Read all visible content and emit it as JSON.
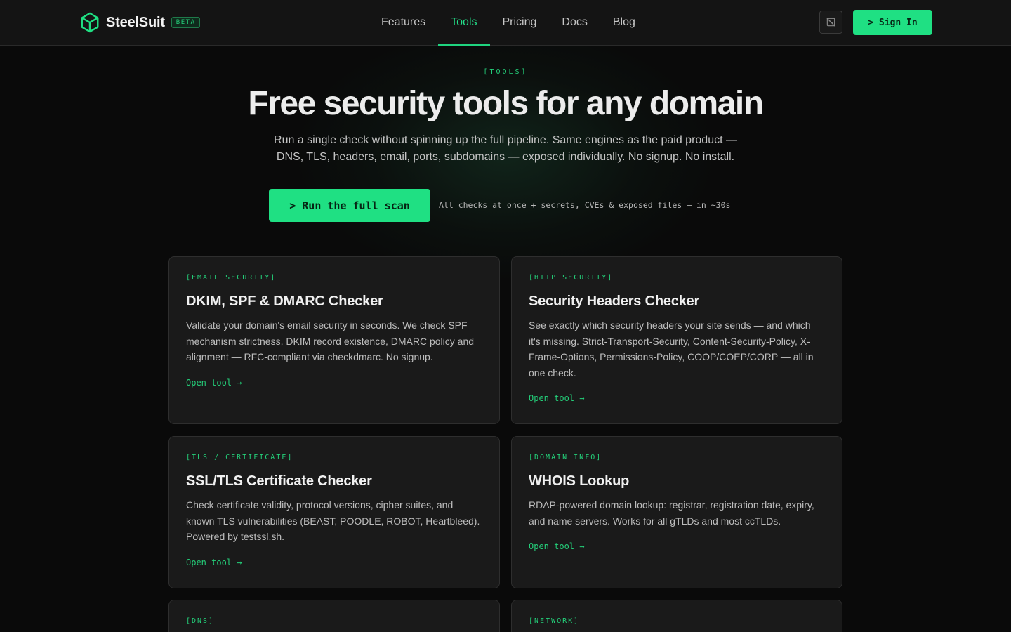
{
  "brand": {
    "name": "SteelSuit",
    "badge": "BETA",
    "accent": "#1fe083"
  },
  "nav": {
    "links": [
      {
        "label": "Features"
      },
      {
        "label": "Tools",
        "active": true
      },
      {
        "label": "Pricing"
      },
      {
        "label": "Docs"
      },
      {
        "label": "Blog"
      }
    ],
    "icon_button": "cookie-settings-icon",
    "signin_label": "> Sign In"
  },
  "hero": {
    "eyebrow": "[TOOLS]",
    "title": "Free security tools for any domain",
    "subtitle": "Run a single check without spinning up the full pipeline. Same engines as the paid product — DNS, TLS, headers, email, ports, subdomains — exposed individually. No signup. No install.",
    "cta_label": "> Run the full scan",
    "cta_note": "All checks at once + secrets, CVEs & exposed files — in ~30s"
  },
  "cards": [
    {
      "tag": "[EMAIL SECURITY]",
      "title": "DKIM, SPF & DMARC Checker",
      "description": "Validate your domain's email security in seconds. We check SPF mechanism strictness, DKIM record existence, DMARC policy and alignment — RFC-compliant via checkdmarc. No signup.",
      "link": "Open tool →"
    },
    {
      "tag": "[HTTP SECURITY]",
      "title": "Security Headers Checker",
      "description": "See exactly which security headers your site sends — and which it's missing. Strict-Transport-Security, Content-Security-Policy, X-Frame-Options, Permissions-Policy, COOP/COEP/CORP — all in one check.",
      "link": "Open tool →"
    },
    {
      "tag": "[TLS / CERTIFICATE]",
      "title": "SSL/TLS Certificate Checker",
      "description": "Check certificate validity, protocol versions, cipher suites, and known TLS vulnerabilities (BEAST, POODLE, ROBOT, Heartbleed). Powered by testssl.sh.",
      "link": "Open tool →"
    },
    {
      "tag": "[DOMAIN INFO]",
      "title": "WHOIS Lookup",
      "description": "RDAP-powered domain lookup: registrar, registration date, expiry, and name servers. Works for all gTLDs and most ccTLDs.",
      "link": "Open tool →"
    },
    {
      "tag": "[DNS]"
    },
    {
      "tag": "[NETWORK]"
    }
  ]
}
